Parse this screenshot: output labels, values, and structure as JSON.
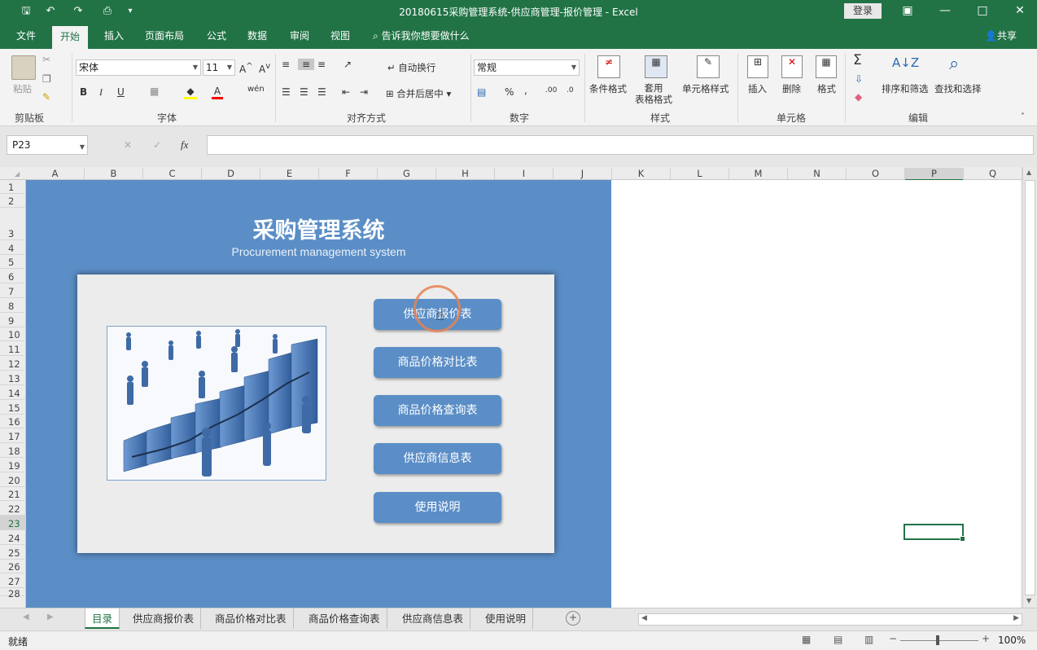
{
  "title_bar": {
    "title": "20180615采购管理系统-供应商管理-报价管理  -  Excel",
    "login": "登录"
  },
  "ribbon_tabs": [
    "文件",
    "开始",
    "插入",
    "页面布局",
    "公式",
    "数据",
    "审阅",
    "视图"
  ],
  "tell_me": "告诉我你想要做什么",
  "share": "共享",
  "ribbon": {
    "paste": "粘贴",
    "font_name": "宋体",
    "font_size": "11",
    "bold": "B",
    "italic": "I",
    "underline": "U",
    "wrap_text": "自动换行",
    "merge_center": "合并后居中",
    "number_format": "常规",
    "conditional_format": "条件格式",
    "table_format": "套用\n表格格式",
    "table_format_l1": "套用",
    "table_format_l2": "表格格式",
    "cell_styles": "单元格样式",
    "insert": "插入",
    "delete": "删除",
    "format": "格式",
    "sort_filter": "排序和筛选",
    "find_select": "查找和选择",
    "groups": [
      "剪贴板",
      "字体",
      "对齐方式",
      "数字",
      "样式",
      "单元格",
      "编辑"
    ]
  },
  "formula_bar": {
    "name_box": "P23",
    "fx": "fx",
    "formula": ""
  },
  "columns": [
    "A",
    "B",
    "C",
    "D",
    "E",
    "F",
    "G",
    "H",
    "I",
    "J",
    "K",
    "L",
    "M",
    "N",
    "O",
    "P",
    "Q"
  ],
  "rows": [
    "1",
    "2",
    "3",
    "4",
    "5",
    "6",
    "7",
    "8",
    "9",
    "10",
    "11",
    "12",
    "13",
    "14",
    "15",
    "16",
    "17",
    "18",
    "19",
    "20",
    "21",
    "22",
    "23",
    "24",
    "25",
    "26",
    "27",
    "28"
  ],
  "dashboard": {
    "title": "采购管理系统",
    "subtitle": "Procurement management system",
    "buttons": [
      "供应商报价表",
      "商品价格对比表",
      "商品价格查询表",
      "供应商信息表",
      "使用说明"
    ]
  },
  "sheet_tabs": [
    "目录",
    "供应商报价表",
    "商品价格对比表",
    "商品价格查询表",
    "供应商信息表",
    "使用说明"
  ],
  "active_sheet": "目录",
  "status": {
    "ready": "就绪",
    "zoom": "100%"
  },
  "colors": {
    "excel_green": "#217346",
    "panel_blue": "#5b8ec6",
    "card_gray": "#ececec"
  }
}
